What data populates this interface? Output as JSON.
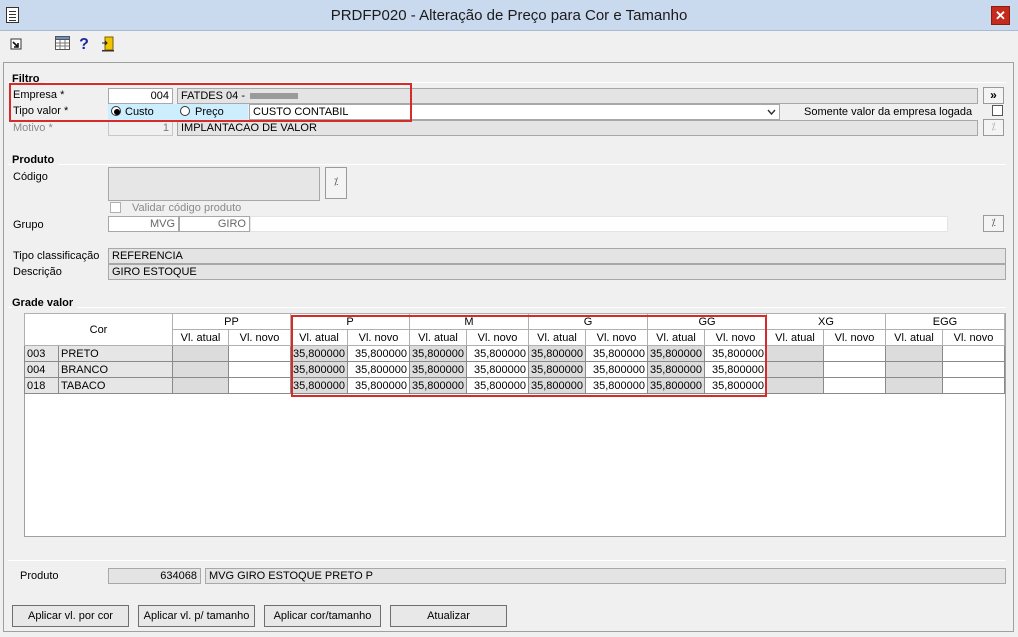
{
  "window": {
    "title": "PRDFP020 - Alteração de Preço para Cor e Tamanho",
    "close_glyph": "✕"
  },
  "toolbar": {
    "icons": [
      "export-icon",
      "calendar-grid-icon",
      "help-icon",
      "exit-door-icon"
    ],
    "help_glyph": "?"
  },
  "filtro": {
    "title": "Filtro",
    "empresa_label": "Empresa *",
    "empresa_code": "004",
    "empresa_name": "FATDES 04 - ",
    "tipo_valor_label": "Tipo valor *",
    "radio_custo": "Custo",
    "radio_preco": "Preço",
    "tipo_select_value": "CUSTO CONTABIL",
    "somente_label": "Somente valor da empresa logada",
    "motivo_label": "Motivo *",
    "motivo_code": "1",
    "motivo_desc": "IMPLANTACAO DE VALOR",
    "expand_glyph": "»",
    "search_glyph": "⁒"
  },
  "produto": {
    "title": "Produto",
    "codigo_label": "Código",
    "validar_label": "Validar código produto",
    "grupo_label": "Grupo",
    "grupo_code1": "MVG",
    "grupo_code2": "GIRO",
    "tipo_class_label": "Tipo classificação",
    "tipo_class_value": "REFERENCIA",
    "descricao_label": "Descrição",
    "descricao_value": "GIRO ESTOQUE"
  },
  "grade": {
    "title": "Grade valor",
    "cor_header": "Cor",
    "sizes": [
      "PP",
      "P",
      "M",
      "G",
      "GG",
      "XG",
      "EGG"
    ],
    "sub_atual": "Vl. atual",
    "sub_novo": "Vl. novo",
    "rows": [
      {
        "code": "003",
        "name": "PRETO",
        "values": [
          "",
          "",
          "35,800000",
          "35,800000",
          "35,800000",
          "35,800000",
          "35,800000",
          "35,800000",
          "35,800000",
          "35,800000",
          "",
          "",
          "",
          ""
        ]
      },
      {
        "code": "004",
        "name": "BRANCO",
        "values": [
          "",
          "",
          "35,800000",
          "35,800000",
          "35,800000",
          "35,800000",
          "35,800000",
          "35,800000",
          "35,800000",
          "35,800000",
          "",
          "",
          "",
          ""
        ]
      },
      {
        "code": "018",
        "name": "TABACO",
        "values": [
          "",
          "",
          "35,800000",
          "35,800000",
          "35,800000",
          "35,800000",
          "35,800000",
          "35,800000",
          "35,800000",
          "35,800000",
          "",
          "",
          "",
          ""
        ]
      }
    ]
  },
  "footer": {
    "produto_label": "Produto",
    "produto_code": "634068",
    "produto_desc": "MVG GIRO ESTOQUE PRETO P",
    "btn_aplicar_cor": "Aplicar vl. por cor",
    "btn_aplicar_tamanho": "Aplicar vl. p/ tamanho",
    "btn_aplicar_cor_tamanho": "Aplicar cor/tamanho",
    "btn_atualizar": "Atualizar"
  },
  "colors": {
    "highlight": "#d62b2b",
    "titlebar": "#c9d9ee",
    "radio_selected_bg": "#cceeff"
  }
}
